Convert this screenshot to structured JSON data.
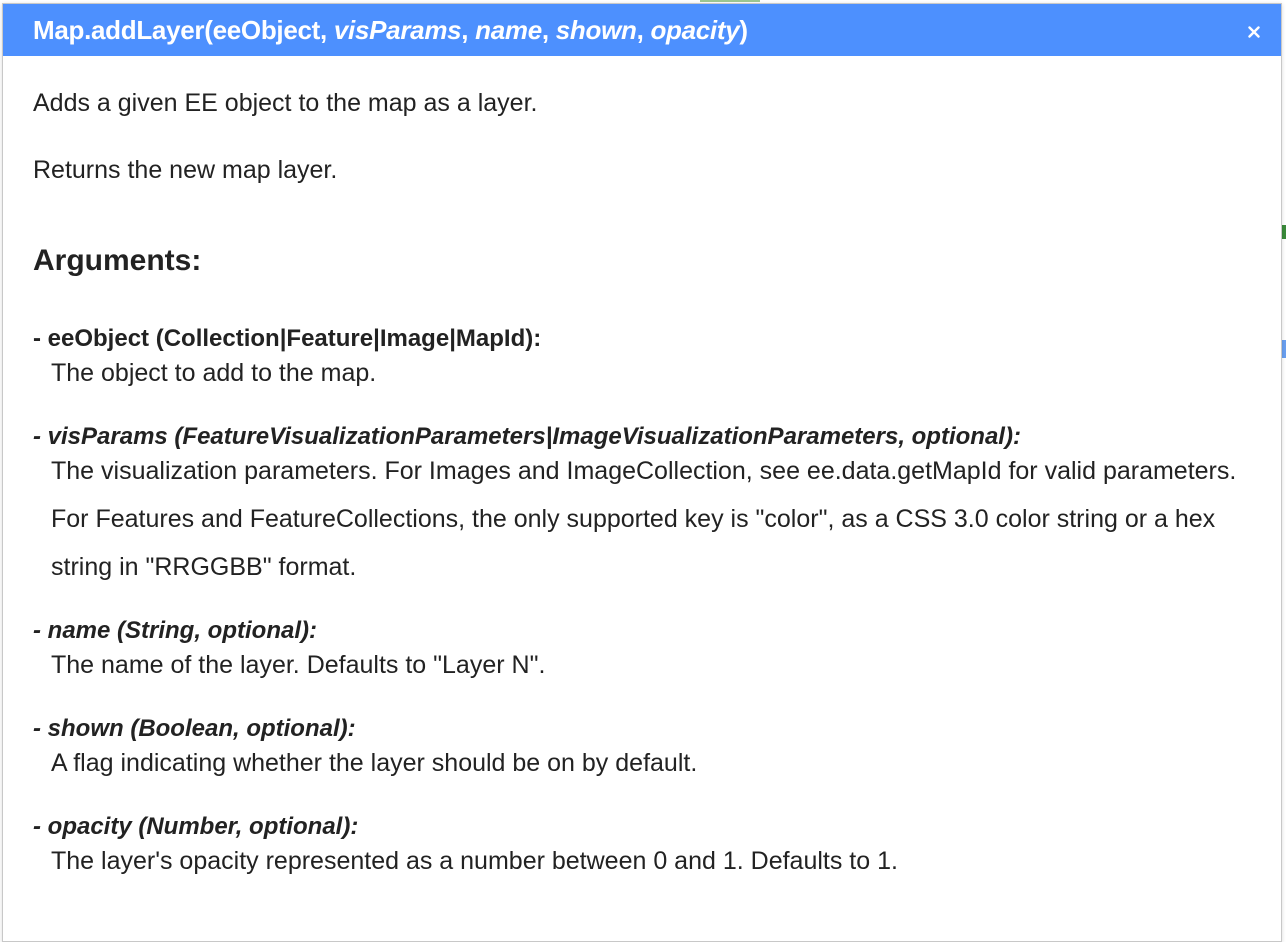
{
  "dialog": {
    "title_prefix": "Map.addLayer(",
    "params": [
      "eeObject",
      "visParams",
      "name",
      "shown",
      "opacity"
    ],
    "sep": ", ",
    "title_suffix": ")",
    "close_icon": "close-icon"
  },
  "description": {
    "line1": "Adds a given EE object to the map as a layer.",
    "line2": "Returns the new map layer."
  },
  "arguments_heading": "Arguments:",
  "arguments": [
    {
      "signature": "- eeObject (Collection|Feature|Image|MapId):",
      "description": "The object to add to the map."
    },
    {
      "signature": "- visParams (FeatureVisualizationParameters|ImageVisualizationParameters, optional):",
      "description": "The visualization parameters. For Images and ImageCollection, see ee.data.getMapId for valid parameters. For Features and FeatureCollections, the only supported key is \"color\", as a CSS 3.0 color string or a hex string in \"RRGGBB\" format."
    },
    {
      "signature": "- name (String, optional):",
      "description": "The name of the layer. Defaults to \"Layer N\"."
    },
    {
      "signature": "- shown (Boolean, optional):",
      "description": "A flag indicating whether the layer should be on by default."
    },
    {
      "signature": "- opacity (Number, optional):",
      "description": "The layer's opacity represented as a number between 0 and 1. Defaults to 1."
    }
  ],
  "colors": {
    "title_bar": "#4d90fe",
    "text": "#222222"
  }
}
